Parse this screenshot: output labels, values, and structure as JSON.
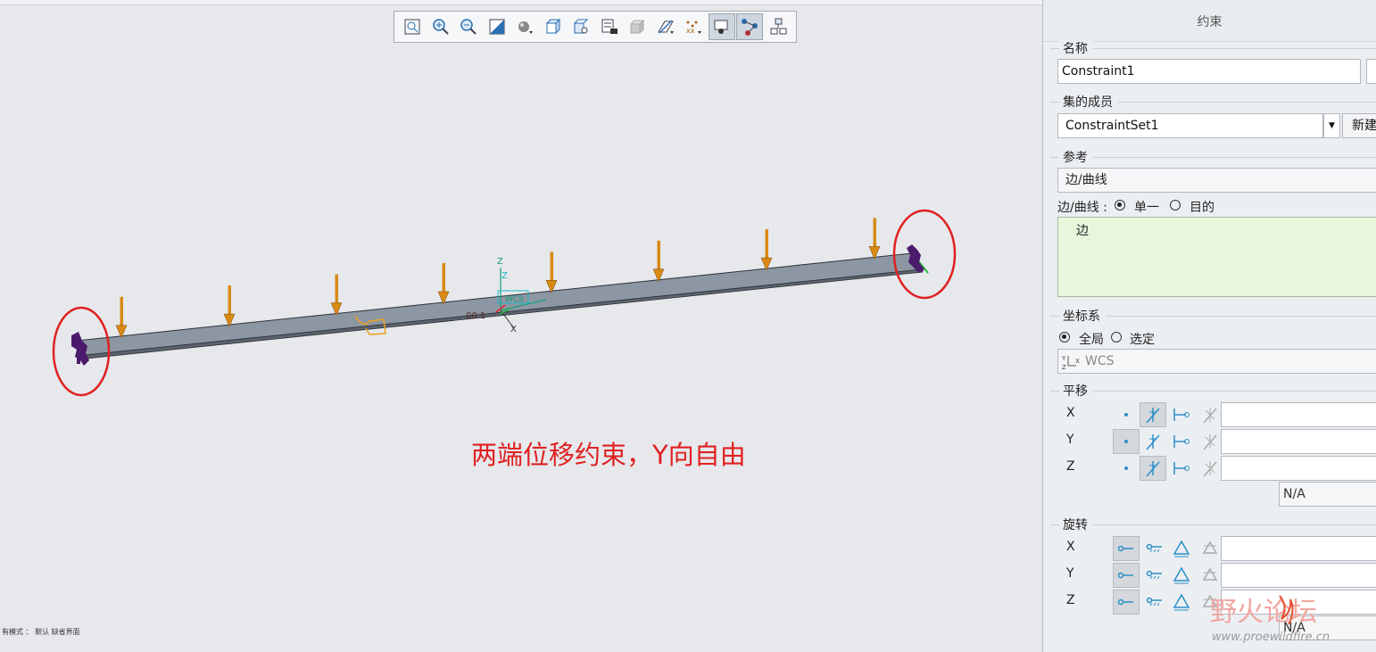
{
  "toolbar": {
    "buttons": [
      {
        "icon": "refit-icon",
        "active": false
      },
      {
        "icon": "zoom-in-icon",
        "active": false
      },
      {
        "icon": "zoom-out-icon",
        "active": false
      },
      {
        "icon": "repaint-icon",
        "active": false
      },
      {
        "icon": "display-style-icon",
        "active": false
      },
      {
        "icon": "saved-views-icon",
        "active": false
      },
      {
        "icon": "view-manager-icon",
        "active": false
      },
      {
        "icon": "perspective-icon",
        "active": false
      },
      {
        "icon": "shaded-view-icon",
        "active": false
      },
      {
        "icon": "datum-display-icon",
        "active": false
      },
      {
        "icon": "annotation-display-icon",
        "active": false
      },
      {
        "icon": "spin-center-icon",
        "active": true
      },
      {
        "icon": "simulation-display-icon",
        "active": true
      },
      {
        "icon": "model-tree-icon",
        "active": false
      }
    ]
  },
  "viewport": {
    "annotation": "两端位移约束，Y向自由",
    "status": "有模式 ： 默认 缺省界面",
    "csys_labels": {
      "z": "Z",
      "x": "X",
      "wcs": "WCS",
      "value": "00 1"
    }
  },
  "panel": {
    "title": "约束",
    "name": {
      "label": "名称",
      "value": "Constraint1"
    },
    "set_member": {
      "label": "集的成员",
      "value": "ConstraintSet1",
      "new_button": "新建"
    },
    "reference": {
      "label": "参考",
      "type_value": "边/曲线",
      "type_label": "边/曲线 :",
      "option_single": "单一",
      "option_intent": "目的",
      "selected_option": "单一",
      "collector_item": "边"
    },
    "csys": {
      "label": "坐标系",
      "option_global": "全局",
      "option_selected": "选定",
      "selected": "全局",
      "value": "WCS"
    },
    "translation": {
      "label": "平移",
      "rows": [
        {
          "axis": "X",
          "selected": "fixed",
          "value": ""
        },
        {
          "axis": "Y",
          "selected": "free",
          "value": ""
        },
        {
          "axis": "Z",
          "selected": "fixed",
          "value": ""
        }
      ],
      "units": "N/A"
    },
    "rotation": {
      "label": "旋转",
      "rows": [
        {
          "axis": "X",
          "selected": "free",
          "value": ""
        },
        {
          "axis": "Y",
          "selected": "free",
          "value": ""
        },
        {
          "axis": "Z",
          "selected": "free",
          "value": ""
        }
      ],
      "units": "N/A"
    }
  },
  "watermark": {
    "text": "野火论坛",
    "url": "www.proewildfire.cn"
  },
  "colors": {
    "annotation": "#e02020",
    "beam": "#8d96a3",
    "load_arrow": "#d88a14",
    "constraint": "#4b1a6b",
    "circle": "#e02020",
    "collector_bg": "#e6f7dc"
  }
}
